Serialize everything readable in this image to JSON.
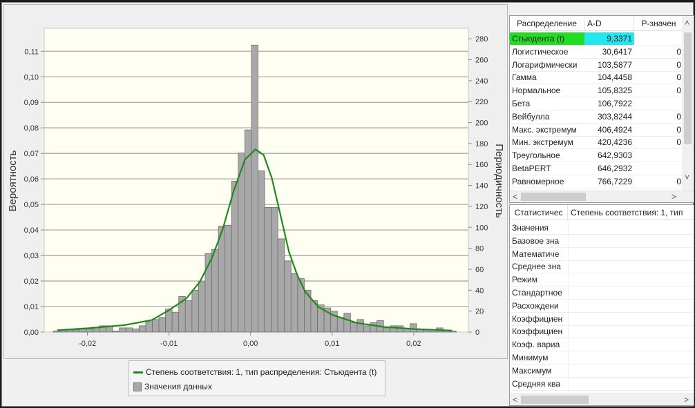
{
  "chart_data": {
    "type": "bar",
    "xlabel": "",
    "ylabel_left": "Вероятность",
    "ylabel_right": "Периодичность",
    "xlim": [
      -0.0253,
      0.0267
    ],
    "ylim_left": [
      0,
      0.119
    ],
    "ylim_right": [
      0,
      290
    ],
    "x_ticks": [
      "-0,02",
      "-0,01",
      "0,00",
      "0,01",
      "0,02"
    ],
    "x_tick_values": [
      -0.02,
      -0.01,
      0,
      0.01,
      0.02
    ],
    "y_left_ticks": [
      "0,00",
      "0,01",
      "0,02",
      "0,03",
      "0,04",
      "0,05",
      "0,06",
      "0,07",
      "0,08",
      "0,09",
      "0,10",
      "0,11"
    ],
    "y_left_tick_values": [
      0,
      0.01,
      0.02,
      0.03,
      0.04,
      0.05,
      0.06,
      0.07,
      0.08,
      0.09,
      0.1,
      0.11
    ],
    "y_right_ticks": [
      "0",
      "20",
      "40",
      "60",
      "80",
      "100",
      "120",
      "140",
      "160",
      "180",
      "200",
      "220",
      "240",
      "260",
      "280"
    ],
    "y_right_tick_values": [
      0,
      20,
      40,
      60,
      80,
      100,
      120,
      140,
      160,
      180,
      200,
      220,
      240,
      260,
      280
    ],
    "grid": true,
    "background": "#fefef2",
    "histogram": {
      "name": "Значения данных",
      "color": "#a8a8a8",
      "bin_start": -0.0242,
      "bin_width": 0.00081,
      "frequencies": [
        1,
        2,
        2,
        2,
        3,
        3,
        4,
        6,
        6,
        1,
        4,
        4,
        3,
        6,
        10,
        12,
        14,
        22,
        19,
        34,
        30,
        40,
        48,
        75,
        79,
        101,
        102,
        144,
        171,
        193,
        274,
        154,
        119,
        119,
        89,
        68,
        56,
        51,
        40,
        30,
        26,
        23,
        20,
        14,
        18,
        9,
        12,
        6,
        9,
        11,
        4,
        6,
        6,
        3,
        8,
        3,
        2,
        2,
        4,
        2,
        1
      ]
    },
    "fit_curve": {
      "name": "Степень соответствия: 1, тип распределения: Стьюдента (t)",
      "color": "#1e8a1e",
      "x": [
        -0.0237,
        -0.02,
        -0.0155,
        -0.0121,
        -0.01,
        -0.0079,
        -0.0062,
        -0.0047,
        -0.0034,
        -0.0021,
        -0.0007,
        0.0006,
        0.0016,
        0.0026,
        0.0036,
        0.0047,
        0.0057,
        0.0067,
        0.0083,
        0.01,
        0.013,
        0.0164,
        0.0201,
        0.0247
      ],
      "y": [
        0.0007,
        0.0015,
        0.0027,
        0.0047,
        0.0086,
        0.0131,
        0.0198,
        0.0293,
        0.0405,
        0.055,
        0.0676,
        0.0716,
        0.0694,
        0.0604,
        0.0468,
        0.0315,
        0.0225,
        0.0158,
        0.0099,
        0.0068,
        0.0036,
        0.002,
        0.0012,
        0.0006
      ]
    },
    "legend": "bottom"
  },
  "fit_table": {
    "headers": [
      "Распределение",
      "A-D",
      "P-значен"
    ],
    "rows": [
      {
        "name": "Стьюдента (t)",
        "ad": "9,3371",
        "p": ""
      },
      {
        "name": "Логистическое",
        "ad": "30,6417",
        "p": "0"
      },
      {
        "name": "Логарифмически",
        "ad": "103,5877",
        "p": "0"
      },
      {
        "name": "Гамма",
        "ad": "104,4458",
        "p": "0"
      },
      {
        "name": "Нормальное",
        "ad": "105,8325",
        "p": "0"
      },
      {
        "name": "Бета",
        "ad": "106,7922",
        "p": ""
      },
      {
        "name": "Вейбулла",
        "ad": "303,8244",
        "p": "0"
      },
      {
        "name": "Макс. экстремум",
        "ad": "406,4924",
        "p": "0"
      },
      {
        "name": "Мин. экстремум",
        "ad": "420,4236",
        "p": "0"
      },
      {
        "name": "Треугольное",
        "ad": "642,9303",
        "p": ""
      },
      {
        "name": "BetaPERT",
        "ad": "646,2932",
        "p": ""
      },
      {
        "name": "Равномерное",
        "ad": "766,7229",
        "p": "0"
      }
    ],
    "selected_name_color": "#22dd22",
    "selected_value_color": "#22e6f0"
  },
  "stat_table": {
    "headers": [
      "Статистичес",
      "Степень соответствия: 1, тип"
    ],
    "rows": [
      "Значения",
      "Базовое зна",
      "Математиче",
      "Среднее зна",
      "Режим",
      "Стандартное",
      "Расхождени",
      "Коэффициен",
      "Коэффициен",
      "Коэф. вариа",
      "Минимум",
      "Максимум",
      "Средняя ква"
    ]
  }
}
